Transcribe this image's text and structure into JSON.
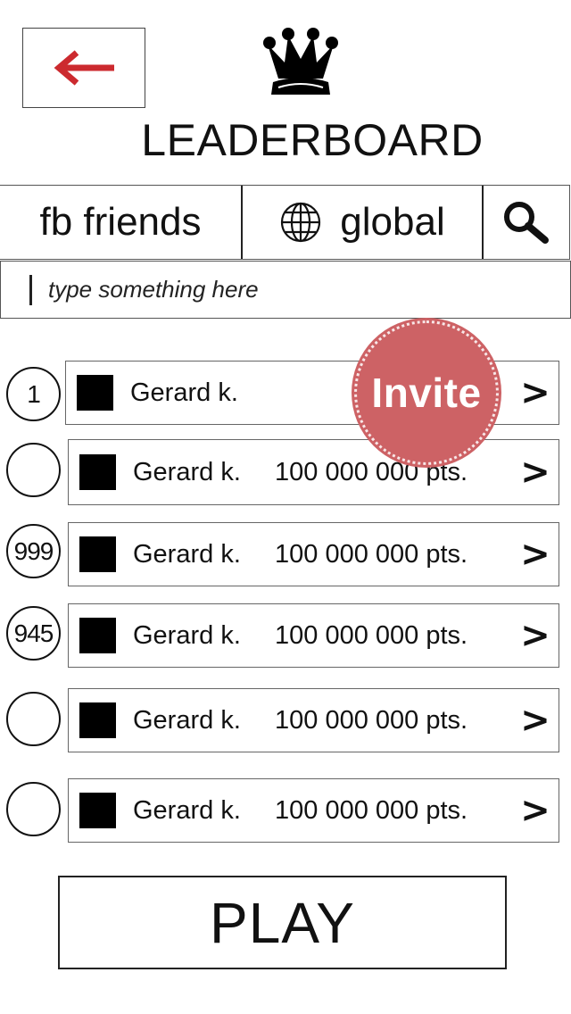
{
  "header": {
    "title": "LEADERBOARD",
    "back_icon": "arrow-left-icon",
    "back_icon_color": "#cc2a2f",
    "crown_icon": "crown-icon"
  },
  "tabs": [
    {
      "label": "fb friends"
    },
    {
      "label": "global",
      "icon": "globe-icon"
    },
    {
      "label": "",
      "icon": "search-icon"
    }
  ],
  "search": {
    "placeholder": "type something here",
    "value": ""
  },
  "invite_badge": {
    "label": "Invite",
    "color": "#cd6265"
  },
  "leaderboard": {
    "rows": [
      {
        "rank": "1",
        "name": "Gerard k.",
        "points": ""
      },
      {
        "rank": "",
        "name": "Gerard k.",
        "points": "100 000 000 pts."
      },
      {
        "rank": "999",
        "name": "Gerard k.",
        "points": "100 000 000 pts."
      },
      {
        "rank": "945",
        "name": "Gerard k.",
        "points": "100 000 000 pts."
      },
      {
        "rank": "",
        "name": "Gerard k.",
        "points": "100 000 000 pts."
      },
      {
        "rank": "",
        "name": "Gerard k.",
        "points": "100 000 000 pts."
      }
    ],
    "chevron": ">"
  },
  "play_button": {
    "label": "PLAY"
  }
}
